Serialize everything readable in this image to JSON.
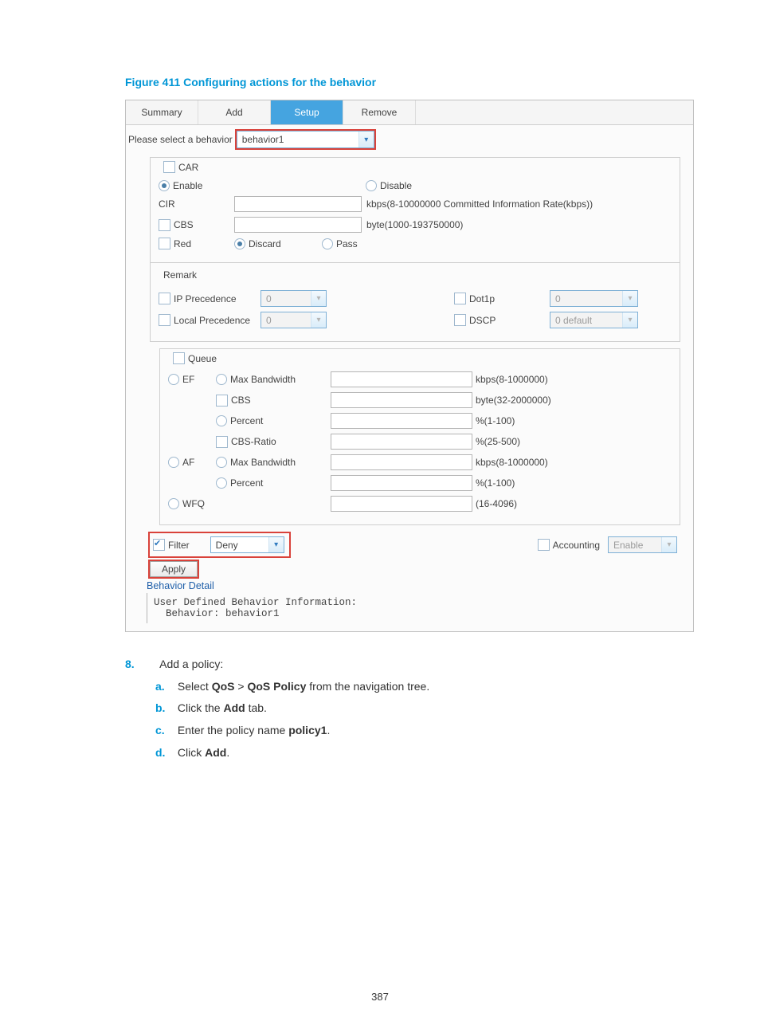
{
  "caption": "Figure 411 Configuring actions for the behavior",
  "tabs": {
    "summary": "Summary",
    "add": "Add",
    "setup": "Setup",
    "remove": "Remove"
  },
  "select": {
    "label": "Please select a behavior",
    "value": "behavior1"
  },
  "car": {
    "legend": "CAR",
    "enable": "Enable",
    "disable": "Disable",
    "cir": "CIR",
    "cir_hint": "kbps(8-10000000 Committed Information Rate(kbps))",
    "cbs": "CBS",
    "cbs_hint": "byte(1000-193750000)",
    "red": "Red",
    "discard": "Discard",
    "pass": "Pass"
  },
  "remark": {
    "legend": "Remark",
    "ipp": "IP Precedence",
    "ipp_val": "0",
    "lp": "Local Precedence",
    "lp_val": "0",
    "dot1p": "Dot1p",
    "dot1p_val": "0",
    "dscp": "DSCP",
    "dscp_val": "0 default"
  },
  "queue": {
    "legend": "Queue",
    "ef": "EF",
    "maxbw": "Max Bandwidth",
    "maxbw_hint": "kbps(8-1000000)",
    "cbs": "CBS",
    "cbs_hint": "byte(32-2000000)",
    "percent": "Percent",
    "percent_hint": "%(1-100)",
    "cbsratio": "CBS-Ratio",
    "cbsratio_hint": "%(25-500)",
    "af": "AF",
    "wfq": "WFQ",
    "wfq_hint": "(16-4096)"
  },
  "bottom": {
    "filter": "Filter",
    "filter_val": "Deny",
    "accounting": "Accounting",
    "accounting_val": "Enable",
    "apply": "Apply"
  },
  "detail": {
    "heading": "Behavior Detail",
    "line1": "User Defined Behavior Information:",
    "line2": "  Behavior: behavior1"
  },
  "steps": {
    "num": "8.",
    "title": "Add a policy:",
    "a_pre": "Select ",
    "a_b1": "QoS",
    "a_mid": " > ",
    "a_b2": "QoS Policy",
    "a_post": " from the navigation tree.",
    "b_pre": "Click the ",
    "b_b": "Add",
    "b_post": " tab.",
    "c_pre": "Enter the policy name ",
    "c_b": "policy1",
    "c_post": ".",
    "d_pre": "Click ",
    "d_b": "Add",
    "d_post": "."
  },
  "page_number": "387"
}
